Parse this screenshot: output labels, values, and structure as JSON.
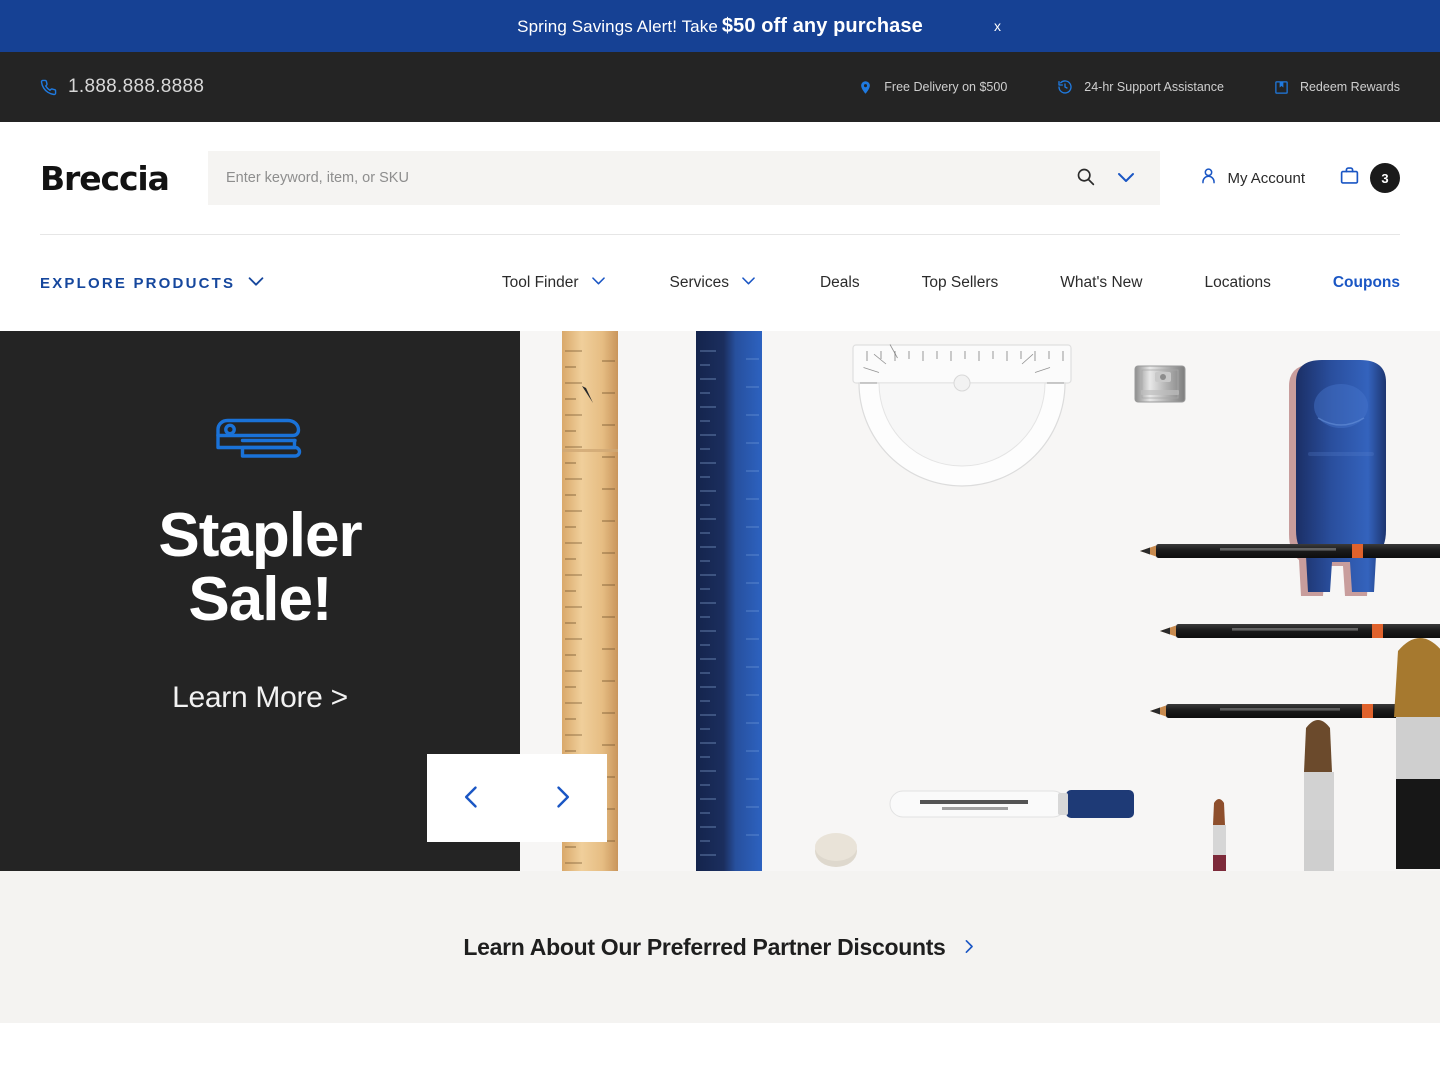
{
  "promo_banner": {
    "text_lead": "Spring Savings Alert! Take",
    "text_strong": "$50 off any purchase",
    "close_label": "x",
    "background": "#164194"
  },
  "utility_bar": {
    "phone": "1.888.888.8888",
    "phone_icon": "phone-icon",
    "links": [
      {
        "label": "Free Delivery on $500",
        "icon": "location-pin-icon"
      },
      {
        "label": "24-hr Support Assistance",
        "icon": "clock-history-icon"
      },
      {
        "label": "Redeem Rewards",
        "icon": "bookmark-icon"
      }
    ],
    "background": "#242424"
  },
  "header": {
    "logo": "Breccia",
    "search": {
      "placeholder": "Enter keyword, item, or SKU",
      "value": "",
      "search_icon": "search-icon",
      "dropdown_icon": "chevron-down-icon"
    },
    "account": {
      "label": "My Account",
      "icon": "person-icon"
    },
    "cart": {
      "icon": "bag-icon",
      "count": "3"
    }
  },
  "nav": {
    "explore": {
      "label": "Explore Products",
      "has_dropdown": true
    },
    "items": [
      {
        "label": "Tool Finder",
        "has_dropdown": true,
        "highlight": false
      },
      {
        "label": "Services",
        "has_dropdown": true,
        "highlight": false
      },
      {
        "label": "Deals",
        "has_dropdown": false,
        "highlight": false
      },
      {
        "label": "Top Sellers",
        "has_dropdown": false,
        "highlight": false
      },
      {
        "label": "What's New",
        "has_dropdown": false,
        "highlight": false
      },
      {
        "label": "Locations",
        "has_dropdown": false,
        "highlight": false
      },
      {
        "label": "Coupons",
        "has_dropdown": false,
        "highlight": true
      }
    ],
    "accent_color": "#16479d"
  },
  "hero": {
    "icon": "stapler-icon",
    "title_line1": "Stapler",
    "title_line2": "Sale!",
    "cta": "Learn More >",
    "panel_background": "#242424",
    "carousel": {
      "prev_label": "Previous slide",
      "next_label": "Next slide"
    },
    "image_description": "Office supplies flat lay: wooden ruler, blue ruler, protractor, pencils, sharpener, blue stapler, red binder clip, marker, eraser, paint brushes"
  },
  "promo_strip": {
    "label": "Learn About Our Preferred Partner Discounts",
    "chevron_icon": "chevron-right-icon",
    "background": "#f4f3f1"
  }
}
